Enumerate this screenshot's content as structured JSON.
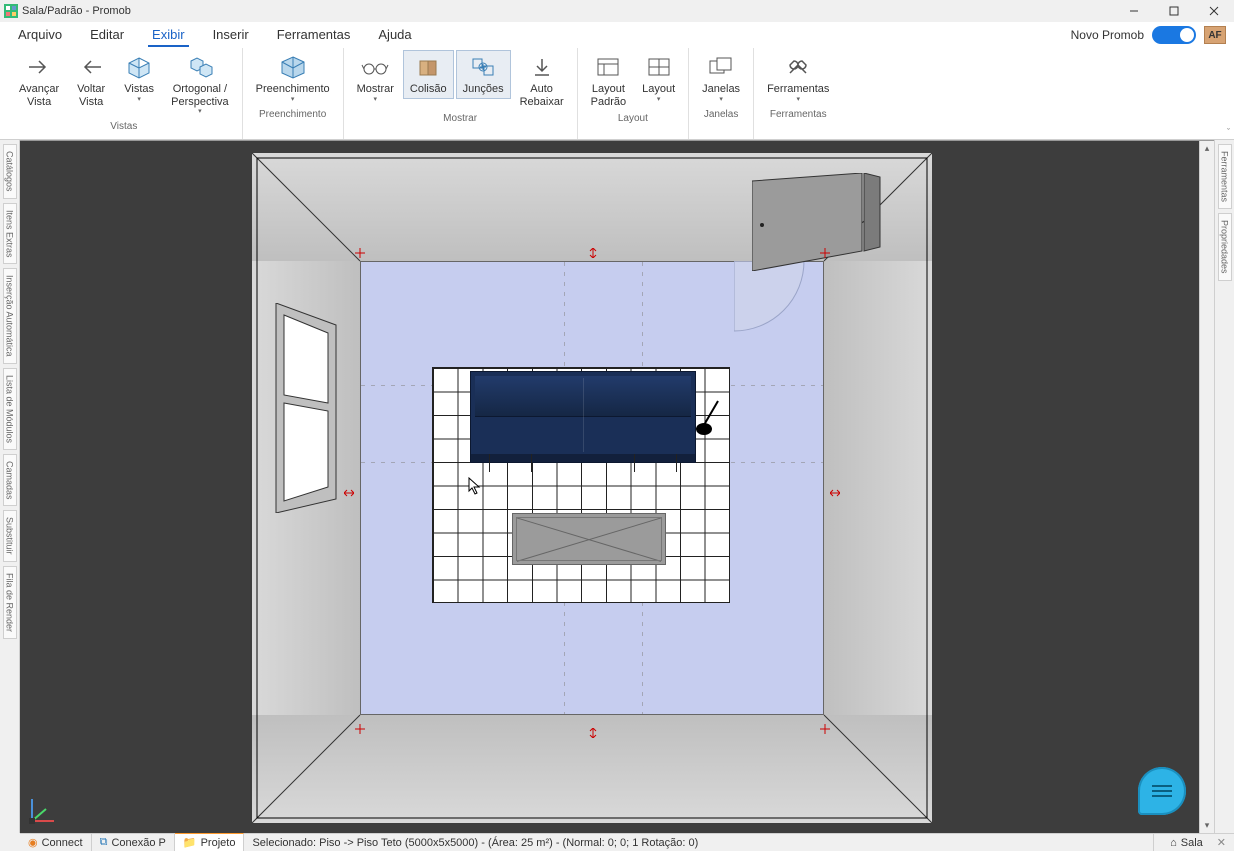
{
  "title": "Sala/Padrão - Promob",
  "menubar": {
    "items": [
      {
        "label": "Arquivo"
      },
      {
        "label": "Editar"
      },
      {
        "label": "Exibir",
        "active": true
      },
      {
        "label": "Inserir"
      },
      {
        "label": "Ferramentas"
      },
      {
        "label": "Ajuda"
      }
    ],
    "novo_label": "Novo Promob",
    "badge": "AF"
  },
  "ribbon": {
    "groups": [
      {
        "label": "Vistas",
        "buttons": [
          {
            "label": "Avançar\nVista",
            "icon": "arrow-right"
          },
          {
            "label": "Voltar\nVista",
            "icon": "arrow-left"
          },
          {
            "label": "Vistas",
            "icon": "cube",
            "dropdown": true
          },
          {
            "label": "Ortogonal /\nPerspectiva",
            "icon": "cubes",
            "dropdown": true
          }
        ]
      },
      {
        "label": "Preenchimento",
        "buttons": [
          {
            "label": "Preenchimento",
            "icon": "fill-cube",
            "dropdown": true
          }
        ]
      },
      {
        "label": "Mostrar",
        "buttons": [
          {
            "label": "Mostrar",
            "icon": "glasses",
            "dropdown": true
          },
          {
            "label": "Colisão",
            "icon": "collision",
            "toggled": true
          },
          {
            "label": "Junções",
            "icon": "junctions",
            "toggled": true
          },
          {
            "label": "Auto\nRebaixar",
            "icon": "auto-lower"
          }
        ]
      },
      {
        "label": "Layout",
        "buttons": [
          {
            "label": "Layout\nPadrão",
            "icon": "layout-default"
          },
          {
            "label": "Layout",
            "icon": "layout-grid",
            "dropdown": true
          }
        ]
      },
      {
        "label": "Janelas",
        "buttons": [
          {
            "label": "Janelas",
            "icon": "windows",
            "dropdown": true
          }
        ]
      },
      {
        "label": "Ferramentas",
        "buttons": [
          {
            "label": "Ferramentas",
            "icon": "tools",
            "dropdown": true
          }
        ]
      }
    ]
  },
  "left_tabs": [
    "Catálogos",
    "Itens Extras",
    "Inserção Automática",
    "Lista de Módulos",
    "Camadas",
    "Substituir",
    "Fila de Render"
  ],
  "right_tabs": [
    "Ferramentas",
    "Propriedades"
  ],
  "bottom": {
    "tabs": [
      {
        "label": "Connect",
        "icon": "rss"
      },
      {
        "label": "Conexão P",
        "icon": "link"
      },
      {
        "label": "Projeto",
        "icon": "folder",
        "active": true
      }
    ],
    "status": "Selecionado: Piso -> Piso Teto (5000x5x5000) - (Área: 25 m²) - (Normal: 0; 0; 1 Rotação: 0)",
    "right_tab": {
      "label": "Sala",
      "icon": "room"
    }
  }
}
